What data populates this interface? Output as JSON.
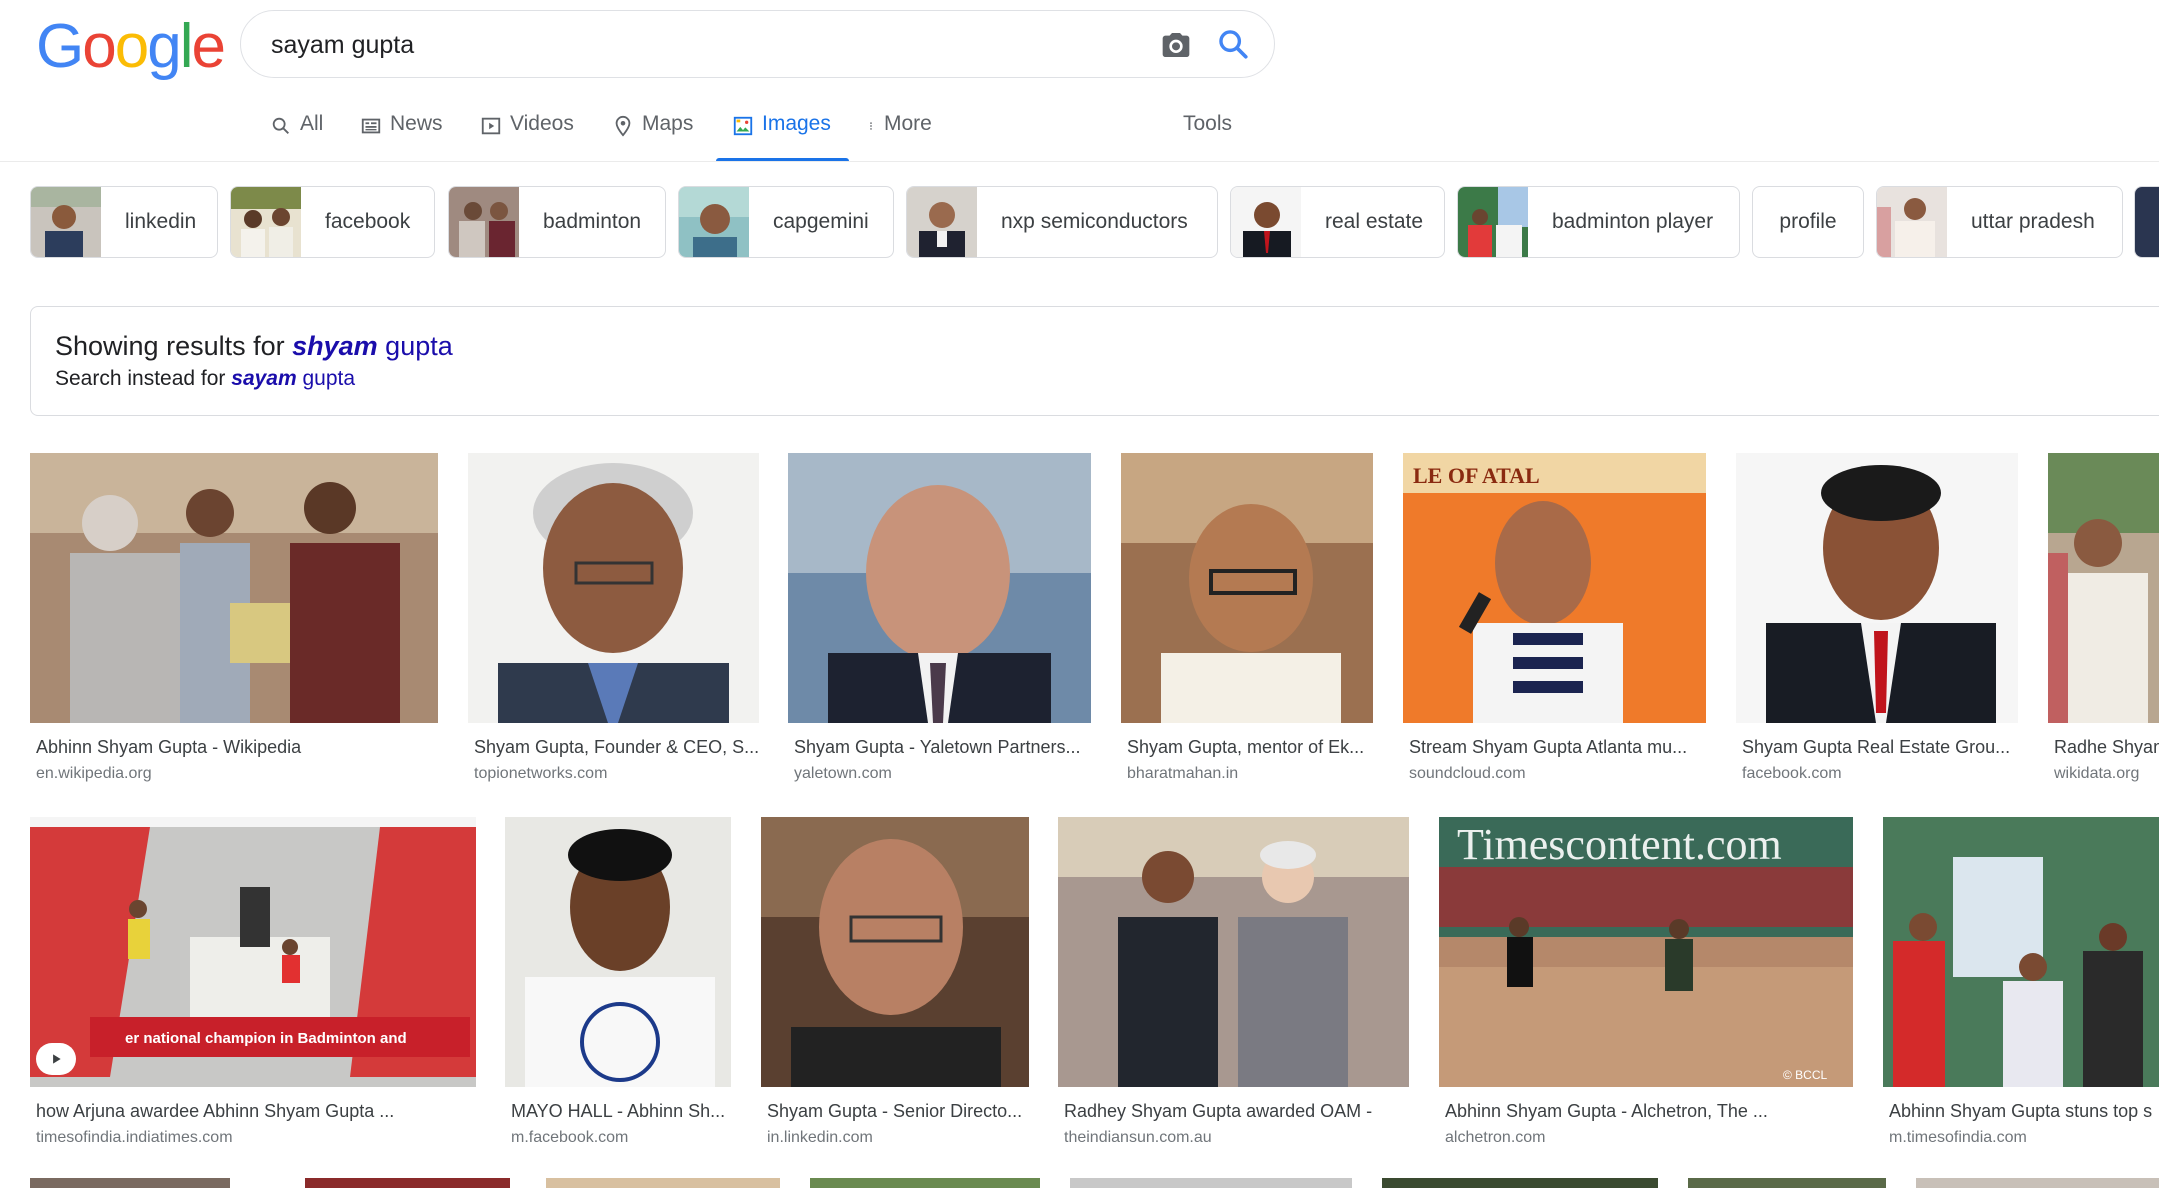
{
  "header": {
    "logo_text": "Google",
    "logo_colors": [
      "#4285F4",
      "#EA4335",
      "#FBBC05",
      "#4285F4",
      "#34A853",
      "#EA4335"
    ],
    "search_query": "sayam gupta",
    "camera_icon": "camera-icon",
    "search_icon": "search-icon"
  },
  "tabs": [
    {
      "label": "All",
      "icon": "search-icon"
    },
    {
      "label": "News",
      "icon": "news-icon"
    },
    {
      "label": "Videos",
      "icon": "play-icon"
    },
    {
      "label": "Maps",
      "icon": "map-pin-icon"
    },
    {
      "label": "Images",
      "icon": "image-icon",
      "active": true
    },
    {
      "label": "More",
      "icon": "more-vert-icon"
    }
  ],
  "tools_label": "Tools",
  "chips": [
    {
      "label": "linkedin"
    },
    {
      "label": "facebook"
    },
    {
      "label": "badminton"
    },
    {
      "label": "capgemini"
    },
    {
      "label": "nxp semiconductors"
    },
    {
      "label": "real estate"
    },
    {
      "label": "badminton player"
    },
    {
      "label": "profile"
    },
    {
      "label": "uttar pradesh"
    }
  ],
  "correction": {
    "showing_prefix": "Showing results for ",
    "showing_bold": "shyam",
    "showing_rest": " gupta",
    "instead_prefix": "Search instead for ",
    "instead_bold": "sayam",
    "instead_rest": " gupta"
  },
  "results_row1": [
    {
      "title": "Abhinn Shyam Gupta - Wikipedia",
      "source": "en.wikipedia.org"
    },
    {
      "title": "Shyam Gupta, Founder & CEO, S...",
      "source": "topionetworks.com"
    },
    {
      "title": "Shyam Gupta - Yaletown Partners...",
      "source": "yaletown.com"
    },
    {
      "title": "Shyam Gupta, mentor of Ek...",
      "source": "bharatmahan.in"
    },
    {
      "title": "Stream Shyam Gupta Atlanta mu...",
      "source": "soundcloud.com"
    },
    {
      "title": "Shyam Gupta Real Estate Grou...",
      "source": "facebook.com"
    },
    {
      "title": "Radhe Shyam",
      "source": "wikidata.org"
    }
  ],
  "results_row2": [
    {
      "title": "how Arjuna awardee Abhinn Shyam Gupta ...",
      "source": "timesofindia.indiatimes.com",
      "overlay_text": "er national champion in Badminton and"
    },
    {
      "title": "MAYO HALL - Abhinn Sh...",
      "source": "m.facebook.com"
    },
    {
      "title": "Shyam Gupta - Senior Directo...",
      "source": "in.linkedin.com"
    },
    {
      "title": "Radhey Shyam Gupta awarded OAM -",
      "source": "theindiansun.com.au"
    },
    {
      "title": "Abhinn Shyam Gupta - Alchetron, The ...",
      "source": "alchetron.com",
      "overlay_text": "Timescontent.com",
      "watermark": "© BCCL"
    },
    {
      "title": "Abhinn Shyam Gupta stuns top s",
      "source": "m.timesofindia.com"
    }
  ]
}
